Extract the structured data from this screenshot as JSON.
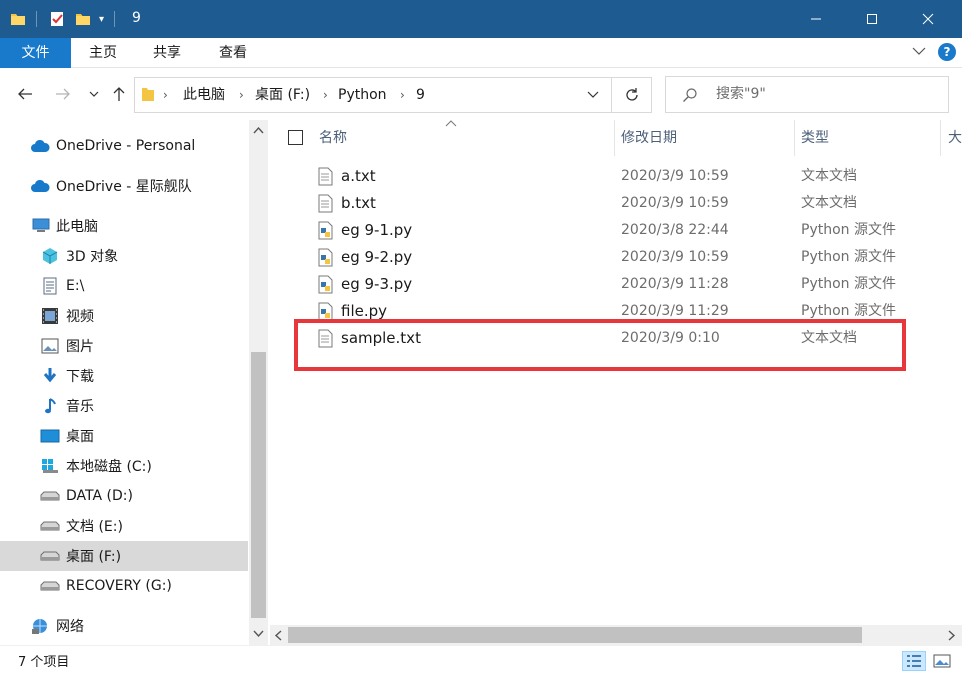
{
  "window": {
    "title": "9",
    "controls": {
      "minimize": "minimize",
      "maximize": "maximize",
      "close": "close"
    }
  },
  "ribbon": {
    "tabs": [
      "文件",
      "主页",
      "共享",
      "查看"
    ]
  },
  "navigation": {
    "breadcrumb": [
      "此电脑",
      "桌面 (F:)",
      "Python",
      "9"
    ],
    "search_placeholder": "搜索\"9\""
  },
  "sidebar": {
    "items": [
      {
        "label": "OneDrive - Personal",
        "icon": "cloud-icon"
      },
      {
        "label": "OneDrive - 星际舰队",
        "icon": "cloud-icon"
      },
      {
        "label": "此电脑",
        "icon": "computer-icon"
      },
      {
        "label": "3D 对象",
        "icon": "3d-objects-icon"
      },
      {
        "label": "E:\\",
        "icon": "document-icon"
      },
      {
        "label": "视频",
        "icon": "video-icon"
      },
      {
        "label": "图片",
        "icon": "pictures-icon"
      },
      {
        "label": "下载",
        "icon": "download-icon"
      },
      {
        "label": "音乐",
        "icon": "music-icon"
      },
      {
        "label": "桌面",
        "icon": "desktop-icon"
      },
      {
        "label": "本地磁盘 (C:)",
        "icon": "windows-drive-icon"
      },
      {
        "label": "DATA (D:)",
        "icon": "drive-icon"
      },
      {
        "label": "文档 (E:)",
        "icon": "drive-icon"
      },
      {
        "label": "桌面 (F:)",
        "icon": "drive-icon",
        "selected": true
      },
      {
        "label": "RECOVERY (G:)",
        "icon": "drive-icon"
      },
      {
        "label": "网络",
        "icon": "network-icon"
      }
    ]
  },
  "file_list": {
    "columns": {
      "name": "名称",
      "date": "修改日期",
      "type": "类型",
      "size": "大"
    },
    "files": [
      {
        "name": "a.txt",
        "date": "2020/3/9 10:59",
        "type": "文本文档",
        "icon": "text-file-icon"
      },
      {
        "name": "b.txt",
        "date": "2020/3/9 10:59",
        "type": "文本文档",
        "icon": "text-file-icon"
      },
      {
        "name": "eg 9-1.py",
        "date": "2020/3/8 22:44",
        "type": "Python 源文件",
        "icon": "python-file-icon"
      },
      {
        "name": "eg 9-2.py",
        "date": "2020/3/9 10:59",
        "type": "Python 源文件",
        "icon": "python-file-icon"
      },
      {
        "name": "eg 9-3.py",
        "date": "2020/3/9 11:28",
        "type": "Python 源文件",
        "icon": "python-file-icon"
      },
      {
        "name": "file.py",
        "date": "2020/3/9 11:29",
        "type": "Python 源文件",
        "icon": "python-file-icon"
      },
      {
        "name": "sample.txt",
        "date": "2020/3/9 0:10",
        "type": "文本文档",
        "icon": "text-file-icon",
        "highlighted": true
      }
    ]
  },
  "status": {
    "item_count": "7 个项目"
  },
  "colors": {
    "titlebar": "#1d5b91",
    "file_tab": "#1979ca",
    "highlight": "#e8363d",
    "selected": "#d9d9d9"
  }
}
